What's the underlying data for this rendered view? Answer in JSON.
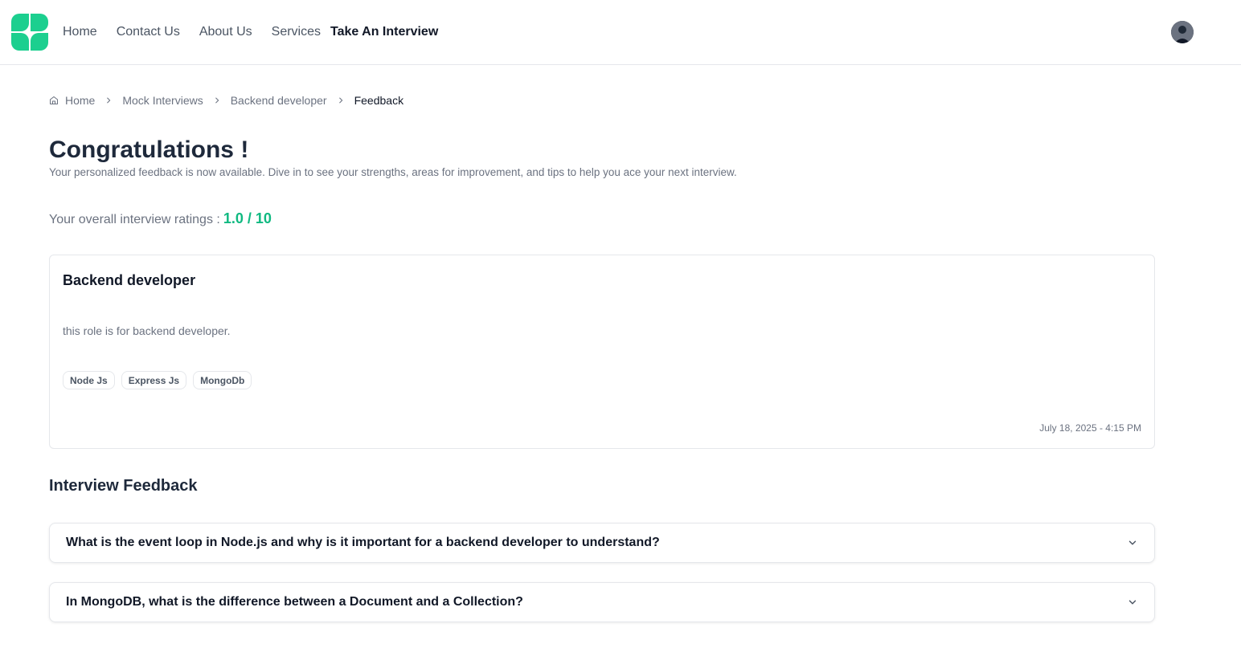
{
  "colors": {
    "brand": "#1ccf8f",
    "accent_text": "#10b981"
  },
  "nav": {
    "links": [
      "Home",
      "Contact Us",
      "About Us",
      "Services"
    ],
    "cta": "Take An Interview"
  },
  "breadcrumb": {
    "items": [
      "Home",
      "Mock Interviews",
      "Backend developer"
    ],
    "current": "Feedback"
  },
  "header": {
    "title": "Congratulations !",
    "subtitle": "Your personalized feedback is now available. Dive in to see your strengths, areas for improvement, and tips to help you ace your next interview."
  },
  "rating": {
    "label": "Your overall interview ratings :",
    "value": "1.0 / 10"
  },
  "interview": {
    "title": "Backend developer",
    "description": "this role is for backend developer.",
    "tags": [
      "Node Js",
      "Express Js",
      "MongoDb"
    ],
    "date": "July 18, 2025 - 4:15 PM"
  },
  "feedback": {
    "title": "Interview Feedback",
    "questions": [
      "What is the event loop in Node.js and why is it important for a backend developer to understand?",
      "In MongoDB, what is the difference between a Document and a Collection?"
    ]
  }
}
